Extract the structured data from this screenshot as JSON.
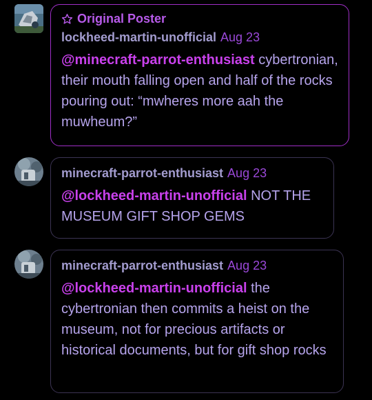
{
  "comments": [
    {
      "badge": "Original Poster",
      "username": "lockheed-martin-unofficial",
      "date": "Aug 23",
      "mention": "@minecraft-parrot-enthusiast",
      "text": "cybertronian, their mouth falling open and half of the rocks pouring out: “mwheres more aah the muwheum?”"
    },
    {
      "username": "minecraft-parrot-enthusiast",
      "date": "Aug 23",
      "mention": "@lockheed-martin-unofficial",
      "text": "NOT THE MUSEUM GIFT SHOP GEMS"
    },
    {
      "username": "minecraft-parrot-enthusiast",
      "date": "Aug 23",
      "mention": "@lockheed-martin-unofficial",
      "text": "the cybertronian then commits a heist on the museum, not for precious artifacts or historical documents, but for gift shop rocks"
    }
  ],
  "icons": {
    "badge": "star-outline-icon"
  },
  "colors": {
    "background": "#000000",
    "op_border": "#a02fc8",
    "border": "#3c3454",
    "username": "#a39ccf",
    "date": "#9a48d8",
    "mention": "#c941ec",
    "text": "#b6a4ec"
  }
}
